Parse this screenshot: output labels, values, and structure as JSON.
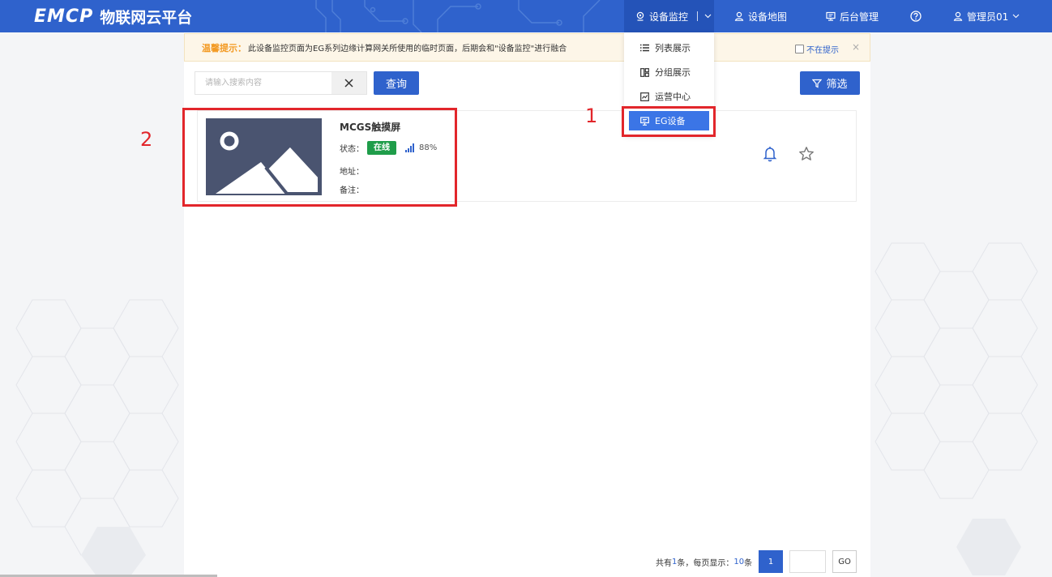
{
  "header": {
    "logo_text": "EMCP",
    "logo_subtitle": "物联网云平台",
    "nav": {
      "device_monitor": "设备监控",
      "device_map": "设备地图",
      "admin": "后台管理",
      "user": "管理员01"
    }
  },
  "tip": {
    "title": "温馨提示：",
    "text": "此设备监控页面为EG系列边缘计算网关所使用的临时页面，后期会和\"设备监控\"进行融合",
    "dismiss_label": "不在提示",
    "close_glyph": "×"
  },
  "search": {
    "placeholder": "请输入搜索内容",
    "query_label": "查询",
    "filter_label": "筛选"
  },
  "dropdown": {
    "items": [
      {
        "label": "列表展示",
        "icon": "list-icon"
      },
      {
        "label": "分组展示",
        "icon": "group-icon"
      },
      {
        "label": "运营中心",
        "icon": "chart-icon"
      },
      {
        "label": "EG设备",
        "icon": "monitor-icon"
      }
    ],
    "active_index": 3
  },
  "device": {
    "name": "MCGS触摸屏",
    "status_label": "状态：",
    "status_value": "在线",
    "signal": "88%",
    "address_label": "地址：",
    "address_value": "",
    "note_label": "备注：",
    "note_value": ""
  },
  "pager": {
    "total_prefix": "共有",
    "total_count": "1",
    "total_mid": "条，每页显示：",
    "page_size": "10",
    "page_size_suffix": "条",
    "current_page": "1",
    "go_label": "GO"
  },
  "annotations": {
    "label_1": "1",
    "label_2": "2"
  },
  "colors": {
    "header_bg": "#2f62cc",
    "accent": "#2f62cc",
    "online_badge": "#1f9d4a",
    "annotation_red": "#e2262b",
    "tip_title": "#f39a23"
  }
}
